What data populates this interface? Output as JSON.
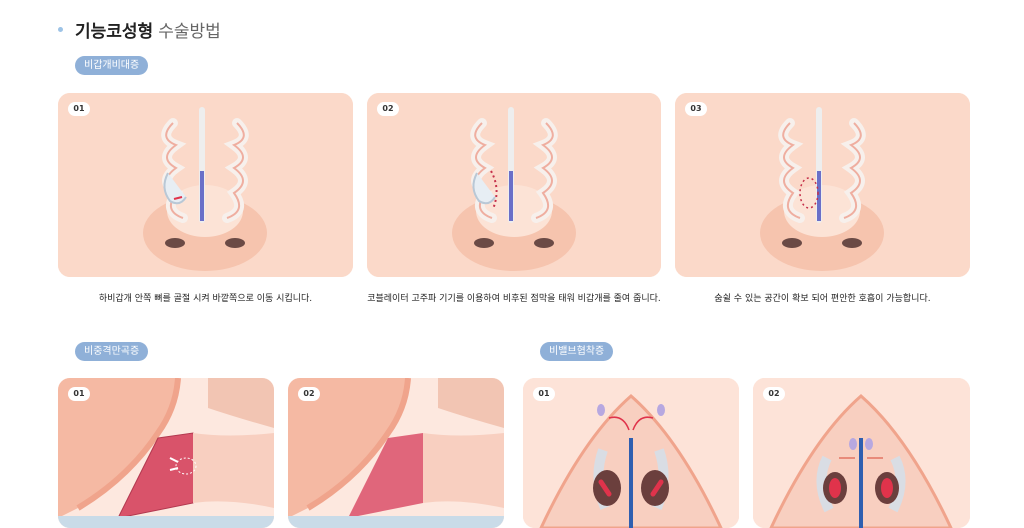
{
  "section": {
    "title_bold": "기능코성형",
    "title_light": "수술방법"
  },
  "turbinate": {
    "tag": "비갑개비대증",
    "steps": [
      {
        "num": "01",
        "caption": "하비갑개 안쪽 뼈를 골절 시켜 바깥쪽으로 이동 시킵니다."
      },
      {
        "num": "02",
        "caption": "코블레이터 고주파 기기를 이용하여 비후된 점막을 태워 비갑개를 줄여 줍니다."
      },
      {
        "num": "03",
        "caption": "숨쉴 수 있는 공간이 확보 되어 편안한 호흡이 가능합니다."
      }
    ]
  },
  "septum": {
    "tag": "비중격만곡증",
    "steps": [
      {
        "num": "01"
      },
      {
        "num": "02"
      }
    ]
  },
  "valve": {
    "tag": "비밸브협착증",
    "steps": [
      {
        "num": "01"
      },
      {
        "num": "02"
      }
    ]
  },
  "colors": {
    "skin": "#fbd9c9",
    "tag": "#8fb0d8",
    "septum_bar": "#6a6fc8",
    "accent_red": "#e0334b"
  }
}
